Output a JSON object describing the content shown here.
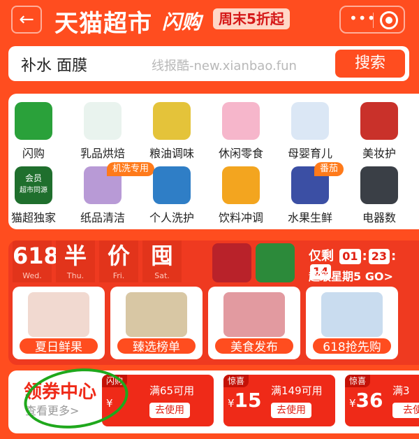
{
  "header": {
    "back_icon": "←",
    "brand": "天猫超市",
    "flash": "闪购",
    "weekend_sale": "周末5折起",
    "more_icon": "•••",
    "record_icon": "record-icon"
  },
  "search": {
    "keyword": "补水 面膜",
    "placeholder": "线报酷-new.xianbao.fun",
    "button": "搜索"
  },
  "categories": [
    {
      "label": "闪购",
      "icon": "tmall-flash-icon",
      "color": "#2aa13a"
    },
    {
      "label": "乳品烘焙",
      "icon": "milk-icon",
      "color": "#e9f3ee"
    },
    {
      "label": "粮油调味",
      "icon": "oil-bottle-icon",
      "color": "#e4c33a"
    },
    {
      "label": "休闲零食",
      "icon": "snack-icon",
      "color": "#f6b6cb"
    },
    {
      "label": "母婴育儿",
      "icon": "formula-can-icon",
      "color": "#dbe7f5"
    },
    {
      "label": "美妆护",
      "icon": "cosmetics-icon",
      "color": "#c9312a"
    },
    {
      "label": "猫超独家",
      "icon": "member-badge-icon",
      "color": "#1f6f2d",
      "badge_top": "会员",
      "badge_bottom": "超市同源"
    },
    {
      "label": "纸品清洁",
      "icon": "tissue-icon",
      "color": "#b89ad6",
      "tag": "机洗专用"
    },
    {
      "label": "个人洗护",
      "icon": "shampoo-icon",
      "color": "#2f7ec6"
    },
    {
      "label": "饮料冲调",
      "icon": "juice-icon",
      "color": "#f3a51f"
    },
    {
      "label": "水果生鲜",
      "icon": "blueberry-icon",
      "color": "#3b4fa4",
      "tag": "番茄"
    },
    {
      "label": "电器数",
      "icon": "phone-icon",
      "color": "#3a3f46"
    }
  ],
  "promo": {
    "days": [
      {
        "big": "618",
        "small": "Wed."
      },
      {
        "big": "半",
        "small": "Thu."
      },
      {
        "big": "价",
        "small": "Fri."
      },
      {
        "big": "囤",
        "small": "Sat."
      }
    ],
    "countdown_label": "仅剩",
    "countdown": [
      "01",
      "23",
      "14"
    ],
    "super_week": "超级星期5 GO>",
    "cards": [
      {
        "label": "夏日鲜果",
        "icon": "lychee-icon",
        "color": "#f1d9d0"
      },
      {
        "label": "臻选榜单",
        "icon": "snack-bag-icon",
        "color": "#d8c7a4"
      },
      {
        "label": "美食发布",
        "icon": "gift-box-icon",
        "color": "#e29aa0"
      },
      {
        "label": "618抢先购",
        "icon": "tissue-pack-icon",
        "color": "#c9dcef"
      }
    ]
  },
  "coupons": {
    "title": "领券中心",
    "more": "查看更多>",
    "items": [
      {
        "badge": "闪购",
        "currency": "¥",
        "amount": "",
        "condition": "满65可用",
        "button": "去使用"
      },
      {
        "badge": "惊喜",
        "currency": "¥",
        "amount": "15",
        "condition": "满149可用",
        "button": "去使用"
      },
      {
        "badge": "惊喜",
        "currency": "¥",
        "amount": "36",
        "condition": "满3",
        "button": "去使"
      }
    ]
  }
}
